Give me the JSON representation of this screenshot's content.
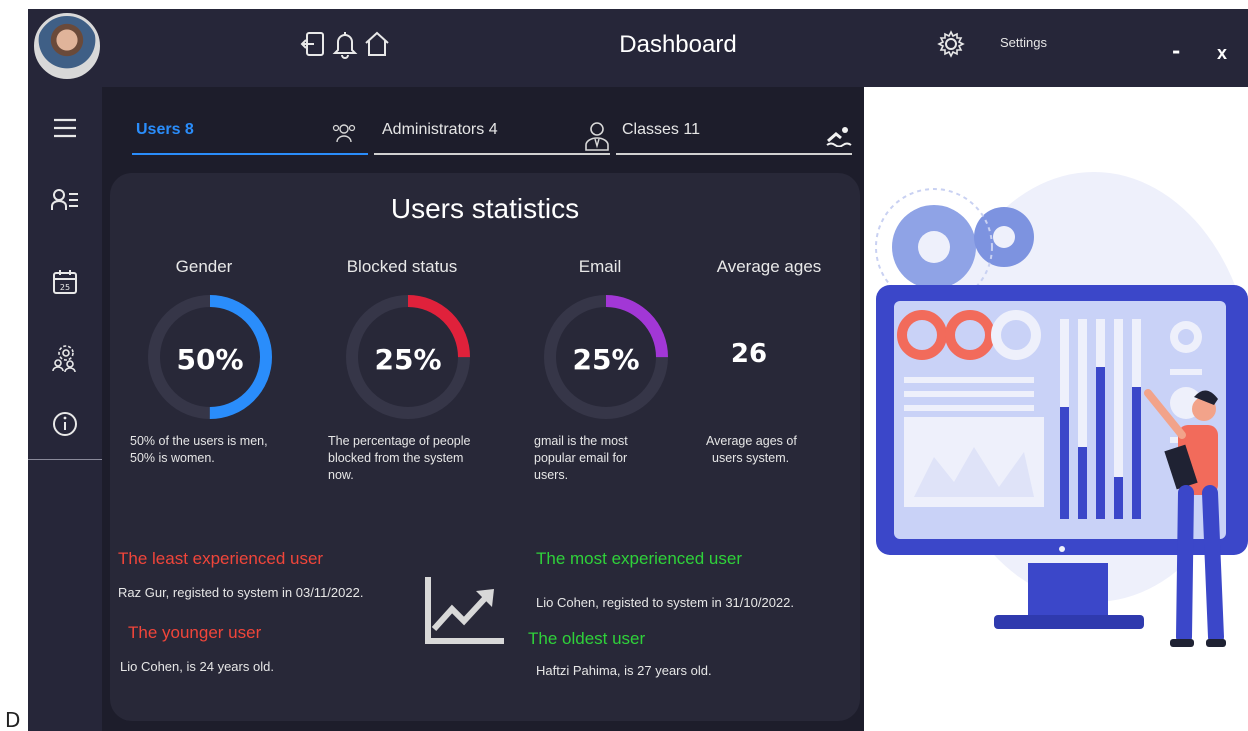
{
  "app": {
    "title": "Dashboard",
    "settings_label": "Settings",
    "minimize_label": "-",
    "close_label": "x",
    "edge_letter": "D"
  },
  "tabs": [
    {
      "label": "Users 8",
      "active": true
    },
    {
      "label": "Administrators 4",
      "active": false
    },
    {
      "label": "Classes 11",
      "active": false
    }
  ],
  "sidebar": {
    "items": [
      {
        "icon": "menu-icon"
      },
      {
        "icon": "users-list-icon"
      },
      {
        "icon": "calendar-icon"
      },
      {
        "icon": "group-settings-icon"
      },
      {
        "icon": "info-icon"
      }
    ],
    "calendar_day": "25"
  },
  "stats": {
    "title": "Users statistics",
    "items": [
      {
        "label": "Gender",
        "value": "50%",
        "percent": 50,
        "color": "#2a8dfb",
        "desc_lines": [
          "50% of the users is men,",
          "50% is women."
        ]
      },
      {
        "label": "Blocked status",
        "value": "25%",
        "percent": 25,
        "color": "#e0213b",
        "desc_lines": [
          "The percentage of people",
          "blocked from the system",
          "now."
        ]
      },
      {
        "label": "Email",
        "value": "25%",
        "percent": 25,
        "color": "#a237d6",
        "desc_lines": [
          "gmail is the most",
          "popular email for",
          "users."
        ]
      },
      {
        "label": "Average ages",
        "value": "26",
        "desc_lines": [
          "Average ages of",
          "users system."
        ]
      }
    ]
  },
  "experience": {
    "least_title": "The least experienced user",
    "least_text": "Raz Gur, registed to system in 03/11/2022.",
    "younger_title": "The younger user",
    "younger_text": "Lio Cohen, is 24 years old.",
    "most_title": "The most experienced user",
    "most_text": "Lio Cohen, registed to system in 31/10/2022.",
    "oldest_title": "The oldest user",
    "oldest_text": "Haftzi Pahima, is 27 years old."
  },
  "colors": {
    "accent": "#2a8dfb",
    "red_heading": "#f0453a",
    "green_heading": "#2fd13a",
    "panel": "#262639",
    "card": "#282838"
  }
}
